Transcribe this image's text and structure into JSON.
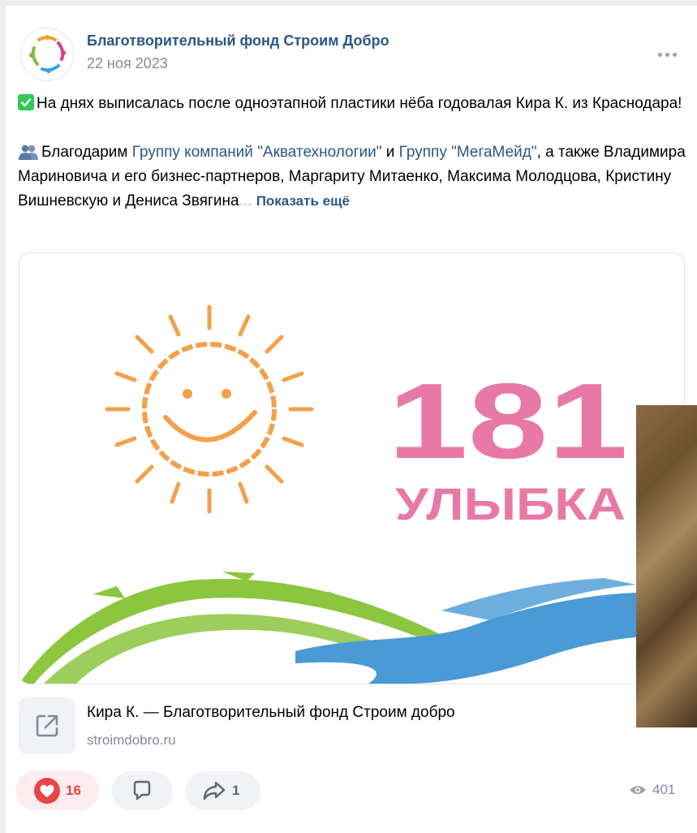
{
  "post": {
    "author": "Благотворительный фонд Строим Добро",
    "date": "22 ноя 2023",
    "paragraph1": "На днях выписалась после одноэтапной пластики нёба годовалая Кира К. из Краснодара!",
    "p2_start": "Благодарим ",
    "p2_link1": "Группу компаний \"Акватехнологии\"",
    "p2_and": " и ",
    "p2_link2": "Группу \"МегаМейд\"",
    "p2_rest": ", а также Владимира Мариновича и его бизнес-партнеров, Маргариту Митаенко, Максима Молодцова, Кристину Вишневскую и Дениса Звягина",
    "p2_fade": "...",
    "show_more": "Показать ещё"
  },
  "image": {
    "number": "181",
    "word": "УЛЫБКА"
  },
  "link": {
    "title": "Кира К. — Благотворительный фонд Строим добро",
    "domain": "stroimdobro.ru",
    "icon": "external-link-icon"
  },
  "actions": {
    "likes": "16",
    "shares": "1",
    "views": "401"
  },
  "colors": {
    "link": "#2a5885",
    "like": "#e64646",
    "pink_text": "#e879a7",
    "sun": "#f2a04a",
    "green": "#8cc63f",
    "blue": "#4a9ad6"
  }
}
